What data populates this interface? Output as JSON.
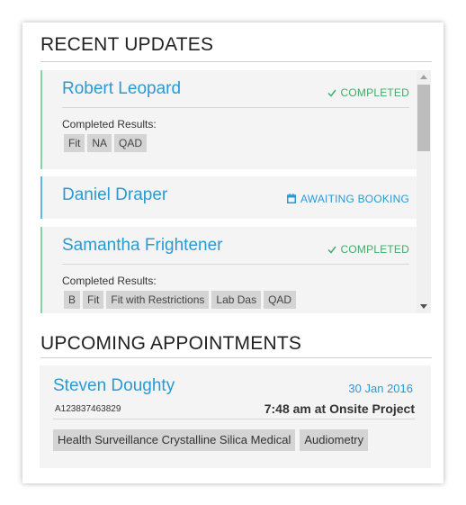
{
  "recent": {
    "title": "RECENT UPDATES",
    "items": [
      {
        "name": "Robert Leopard",
        "status": "COMPLETED",
        "status_icon": "check-icon",
        "results_label": "Completed Results:",
        "tags": [
          "Fit",
          "NA",
          "QAD"
        ]
      },
      {
        "name": "Daniel Draper",
        "status": "AWAITING BOOKING",
        "status_icon": "calendar-icon"
      },
      {
        "name": "Samantha Frightener",
        "status": "COMPLETED",
        "status_icon": "check-icon",
        "results_label": "Completed Results:",
        "tags": [
          "B",
          "Fit",
          "Fit with Restrictions",
          "Lab Das",
          "QAD"
        ]
      }
    ]
  },
  "upcoming": {
    "title": "UPCOMING APPOINTMENTS",
    "appointment": {
      "name": "Steven Doughty",
      "date": "30 Jan 2016",
      "id": "A123837463829",
      "time": "7:48 am at Onsite Project",
      "tags": [
        "Health Surveillance Crystalline Silica Medical",
        "Audiometry"
      ]
    }
  },
  "colors": {
    "accent_blue": "#2a9ad3",
    "completed_green": "#3cae6b"
  }
}
